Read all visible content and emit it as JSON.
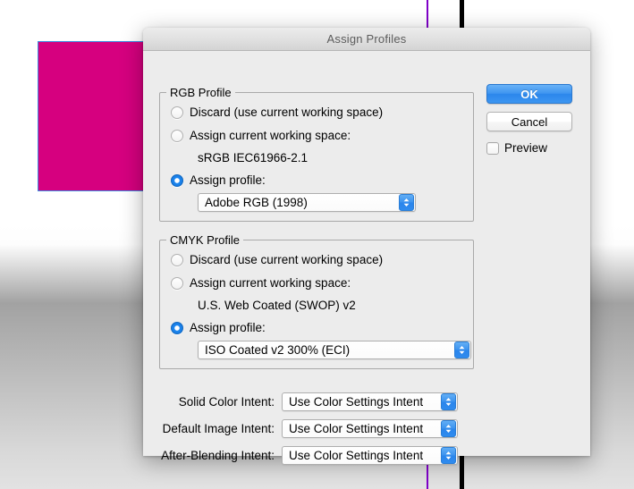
{
  "background": {
    "artwork_fill": "#d6007f",
    "artwork_border": "#3f8ae0",
    "guide_purple": "#7f00c8",
    "guide_black": "#000000"
  },
  "dialog": {
    "title": "Assign Profiles",
    "rgb_group": {
      "legend": "RGB Profile",
      "options": [
        {
          "label": "Discard (use current working space)",
          "selected": false
        },
        {
          "label": "Assign current working space:",
          "selected": false
        },
        {
          "label": "Assign profile:",
          "selected": true
        }
      ],
      "working_space_value": "sRGB IEC61966-2.1",
      "profile_combo_value": "Adobe RGB (1998)"
    },
    "cmyk_group": {
      "legend": "CMYK Profile",
      "options": [
        {
          "label": "Discard (use current working space)",
          "selected": false
        },
        {
          "label": "Assign current working space:",
          "selected": false
        },
        {
          "label": "Assign profile:",
          "selected": true
        }
      ],
      "working_space_value": "U.S. Web Coated (SWOP) v2",
      "profile_combo_value": "ISO Coated v2 300% (ECI)"
    },
    "intents": [
      {
        "label": "Solid Color Intent:",
        "value": "Use Color Settings Intent"
      },
      {
        "label": "Default Image Intent:",
        "value": "Use Color Settings Intent"
      },
      {
        "label": "After-Blending Intent:",
        "value": "Use Color Settings Intent"
      }
    ],
    "buttons": {
      "ok": "OK",
      "cancel": "Cancel"
    },
    "preview": {
      "label": "Preview",
      "checked": false
    },
    "accent_color": "#2b86ec"
  }
}
